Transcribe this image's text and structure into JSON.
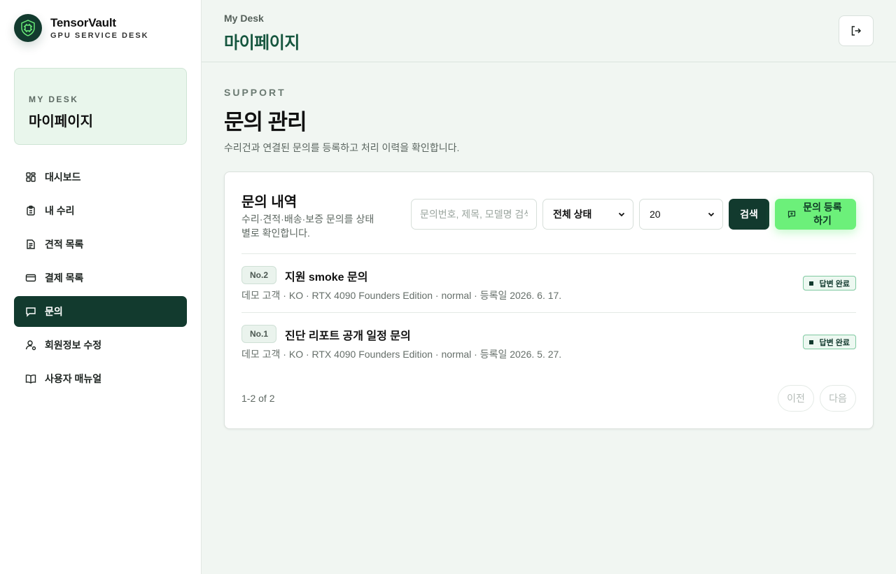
{
  "brand": {
    "name": "TensorVault",
    "subtitle": "GPU SERVICE DESK"
  },
  "desk_card": {
    "eyebrow": "MY DESK",
    "title": "마이페이지"
  },
  "sidebar": {
    "items": [
      {
        "label": "대시보드",
        "icon": "dashboard-icon",
        "active": false
      },
      {
        "label": "내 수리",
        "icon": "clipboard-icon",
        "active": false
      },
      {
        "label": "견적 목록",
        "icon": "document-icon",
        "active": false
      },
      {
        "label": "결제 목록",
        "icon": "card-icon",
        "active": false
      },
      {
        "label": "문의",
        "icon": "chat-icon",
        "active": true
      },
      {
        "label": "회원정보 수정",
        "icon": "user-settings-icon",
        "active": false
      },
      {
        "label": "사용자 매뉴얼",
        "icon": "book-icon",
        "active": false
      }
    ]
  },
  "header": {
    "breadcrumb": "My Desk",
    "title": "마이페이지",
    "logout_icon": "logout-icon"
  },
  "page": {
    "eyebrow": "SUPPORT",
    "title": "문의 관리",
    "description": "수리건과 연결된 문의를 등록하고 처리 이력을 확인합니다."
  },
  "panel": {
    "title": "문의 내역",
    "description": "수리·견적·배송·보증 문의를 상태별로 확인합니다.",
    "search": {
      "placeholder": "문의번호, 제목, 모델명 검색",
      "value": ""
    },
    "status_select": {
      "selected": "전체 상태"
    },
    "size_select": {
      "selected": "20"
    },
    "search_button": "검색",
    "new_button": "문의 등록하기",
    "rows": [
      {
        "no": "No.2",
        "title": "지원 smoke 문의",
        "meta": "데모 고객 · KO · RTX 4090 Founders Edition · normal · 등록일 2026. 6. 17.",
        "status": "답변 완료"
      },
      {
        "no": "No.1",
        "title": "진단 리포트 공개 일정 문의",
        "meta": "데모 고객 · KO · RTX 4090 Founders Edition · normal · 등록일 2026. 5. 27.",
        "status": "답변 완료"
      }
    ],
    "count": "1-2 of 2",
    "prev": "이전",
    "next": "다음"
  },
  "colors": {
    "primary": "#123a2e",
    "accent": "#6cf07a",
    "title_green": "#16563f",
    "background": "#f1f6f2"
  }
}
